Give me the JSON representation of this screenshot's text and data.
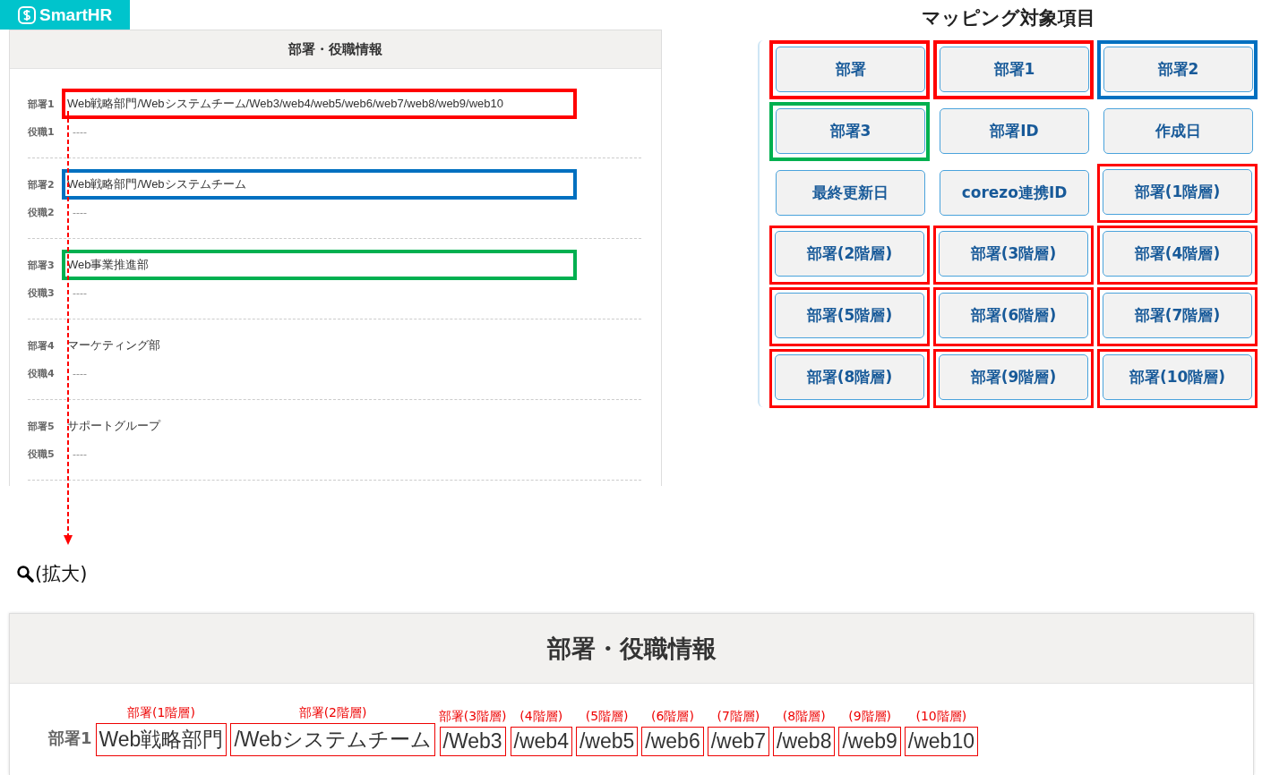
{
  "logo": {
    "text": "SmartHR"
  },
  "left_panel": {
    "title": "部署・役職情報",
    "rows": [
      {
        "dept_label": "部署1",
        "dept_value": "Web戦略部門/Webシステムチーム/Web3/web4/web5/web6/web7/web8/web9/web10",
        "role_label": "役職1",
        "role_value": "----",
        "color": "#ff0000"
      },
      {
        "dept_label": "部署2",
        "dept_value": "Web戦略部門/Webシステムチーム",
        "role_label": "役職2",
        "role_value": "----",
        "color": "#0070c0"
      },
      {
        "dept_label": "部署3",
        "dept_value": "Web事業推進部",
        "role_label": "役職3",
        "role_value": "----",
        "color": "#00b050"
      },
      {
        "dept_label": "部署4",
        "dept_value": "マーケティング部",
        "role_label": "役職4",
        "role_value": "----"
      },
      {
        "dept_label": "部署5",
        "dept_value": "サポートグループ",
        "role_label": "役職5",
        "role_value": "----"
      }
    ]
  },
  "zoom_caption": "(拡大)",
  "mapping": {
    "title": "マッピング対象項目",
    "items": [
      {
        "label": "部署",
        "kind": "thick",
        "color": "#ff0000"
      },
      {
        "label": "部署1",
        "kind": "thick",
        "color": "#ff0000"
      },
      {
        "label": "部署2",
        "kind": "thick",
        "color": "#0070c0"
      },
      {
        "label": "部署3",
        "kind": "thick",
        "color": "#00b050"
      },
      {
        "label": "部署ID",
        "kind": "plain"
      },
      {
        "label": "作成日",
        "kind": "plain"
      },
      {
        "label": "最終更新日",
        "kind": "plain"
      },
      {
        "label": "corezo連携ID",
        "kind": "plain"
      },
      {
        "label": "部署(1階層)",
        "kind": "thin",
        "color": "#ff0000"
      },
      {
        "label": "部署(2階層)",
        "kind": "thin",
        "color": "#ff0000"
      },
      {
        "label": "部署(3階層)",
        "kind": "thin",
        "color": "#ff0000"
      },
      {
        "label": "部署(4階層)",
        "kind": "thin",
        "color": "#ff0000"
      },
      {
        "label": "部署(5階層)",
        "kind": "thin",
        "color": "#ff0000"
      },
      {
        "label": "部署(6階層)",
        "kind": "thin",
        "color": "#ff0000"
      },
      {
        "label": "部署(7階層)",
        "kind": "thin",
        "color": "#ff0000"
      },
      {
        "label": "部署(8階層)",
        "kind": "thin",
        "color": "#ff0000"
      },
      {
        "label": "部署(9階層)",
        "kind": "thin",
        "color": "#ff0000"
      },
      {
        "label": "部署(10階層)",
        "kind": "thin",
        "color": "#ff0000"
      }
    ]
  },
  "zoomed_panel": {
    "title": "部署・役職情報",
    "label": "部署1",
    "segments": [
      {
        "caption": "部署(1階層)",
        "text": "Web戦略部門"
      },
      {
        "caption": "部署(2階層)",
        "text": "/Webシステムチーム"
      },
      {
        "caption": "部署(3階層)",
        "text": "/Web3"
      },
      {
        "caption": "(4階層)",
        "text": "/web4"
      },
      {
        "caption": "(5階層)",
        "text": "/web5"
      },
      {
        "caption": "(6階層)",
        "text": "/web6"
      },
      {
        "caption": "(7階層)",
        "text": "/web7"
      },
      {
        "caption": "(8階層)",
        "text": "/web8"
      },
      {
        "caption": "(9階層)",
        "text": "/web9"
      },
      {
        "caption": "(10階層)",
        "text": "/web10"
      }
    ]
  }
}
